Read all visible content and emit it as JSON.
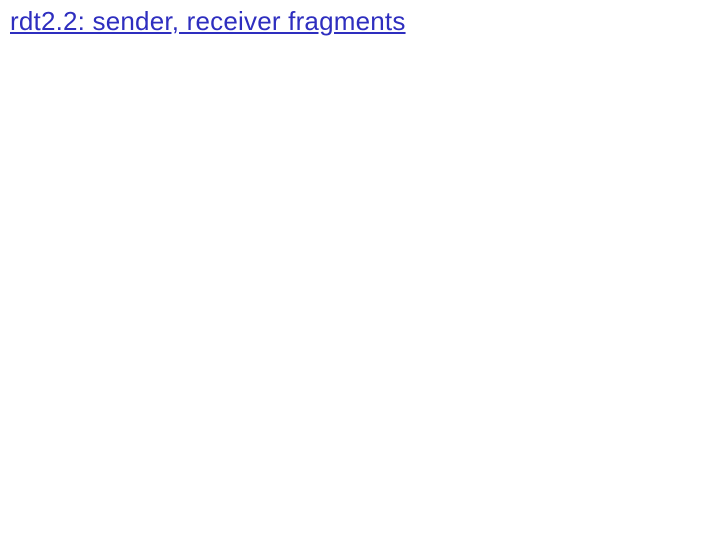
{
  "slide": {
    "title": "rdt2.2: sender, receiver fragments"
  }
}
